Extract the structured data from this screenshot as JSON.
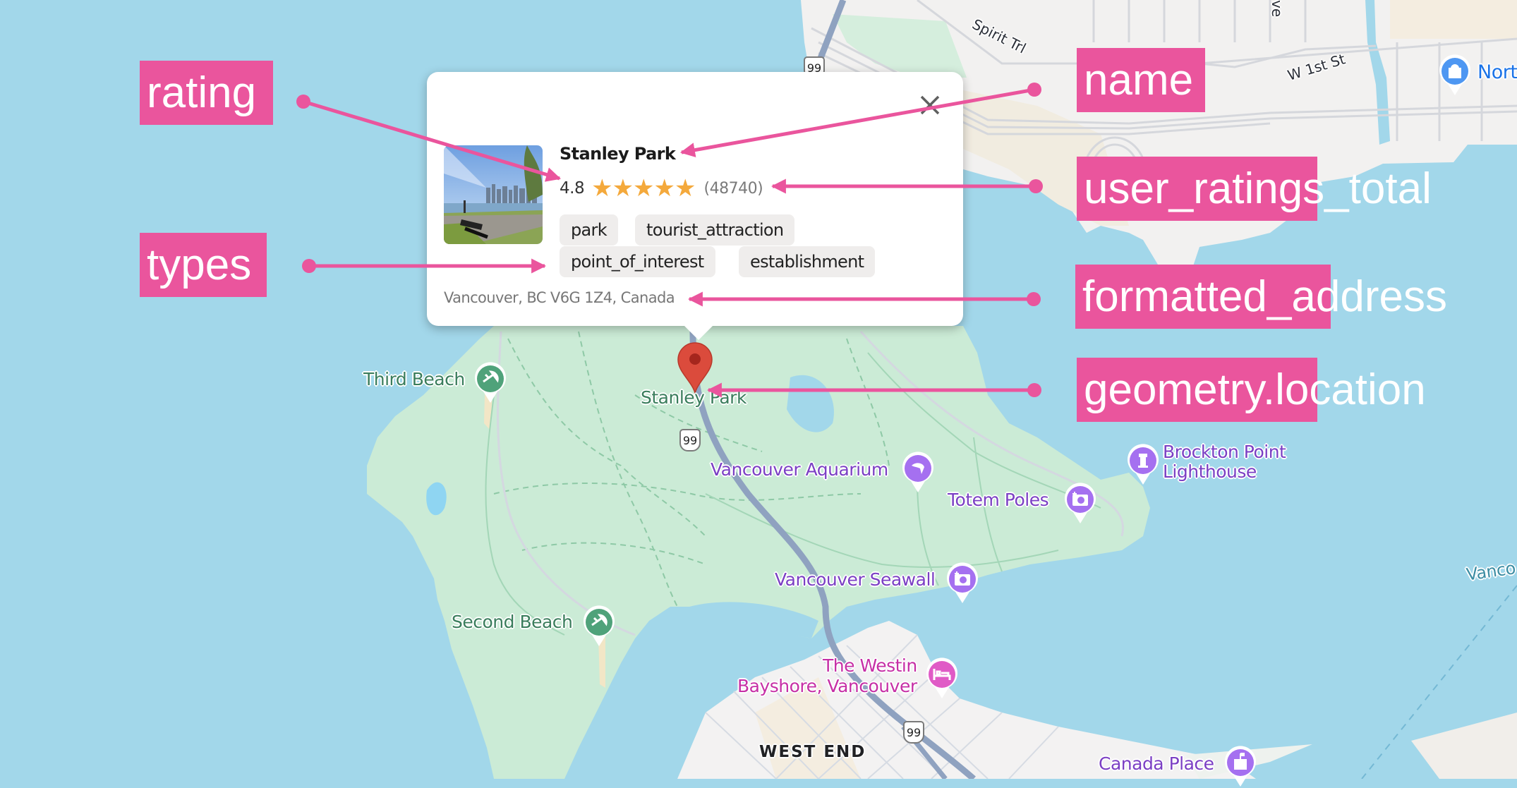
{
  "map": {
    "highway_shield": "99",
    "street_labels": [
      "Spirit Trl",
      "W 1st St",
      "ve"
    ],
    "pois": [
      {
        "name": "Third Beach",
        "category": "beach",
        "icon": "beach-umbrella-icon",
        "color": "#4fa27a"
      },
      {
        "name": "Second Beach",
        "category": "beach",
        "icon": "beach-umbrella-icon",
        "color": "#4fa27a"
      },
      {
        "name": "Stanley Park",
        "category": "park",
        "icon": "map-pin-icon",
        "color": "#db4b3c"
      },
      {
        "name": "Vancouver Aquarium",
        "category": "attraction",
        "icon": "dolphin-icon",
        "color": "#a570f0"
      },
      {
        "name": "Totem Poles",
        "category": "attraction",
        "icon": "camera-icon",
        "color": "#a570f0"
      },
      {
        "name": "Brockton Point Lighthouse",
        "lines": [
          "Brockton Point",
          "Lighthouse"
        ],
        "category": "landmark",
        "icon": "lighthouse-icon",
        "color": "#a570f0"
      },
      {
        "name": "Vancouver Seawall",
        "category": "attraction",
        "icon": "camera-icon",
        "color": "#a570f0"
      },
      {
        "name": "The Westin Bayshore, Vancouver",
        "lines": [
          "The Westin",
          "Bayshore, Vancouver"
        ],
        "category": "hotel",
        "icon": "bed-icon",
        "color": "#e05bc6"
      },
      {
        "name": "Canada Place",
        "category": "landmark",
        "icon": "building-icon",
        "color": "#a570f0"
      },
      {
        "name": "Nort",
        "category": "shopping",
        "icon": "shopping-bag-icon",
        "color": "#4e97f2"
      }
    ],
    "district_label": "WEST END",
    "water_label": "Vanco"
  },
  "card": {
    "name": "Stanley Park",
    "rating": "4.8",
    "rating_value": 4.8,
    "stars_max": 5,
    "user_ratings_total": "(48740)",
    "types": [
      "park",
      "tourist_attraction",
      "point_of_interest",
      "establishment"
    ],
    "formatted_address": "Vancouver, BC V6G 1Z4, Canada",
    "close_icon": "close-icon",
    "photo_alt": "Stanley Park seawall photo"
  },
  "annotations": {
    "rating": "rating",
    "types": "types",
    "name": "name",
    "user_ratings_total": "user_ratings_total",
    "formatted_address": "formatted_address",
    "geometry_location": "geometry.location"
  },
  "colors": {
    "annotation": "#ea559d",
    "water": "#a2d7ea",
    "park": "#cbebd6",
    "urban": "#f3f2f2",
    "star": "#f4a93c",
    "chip_bg": "#efedec"
  }
}
